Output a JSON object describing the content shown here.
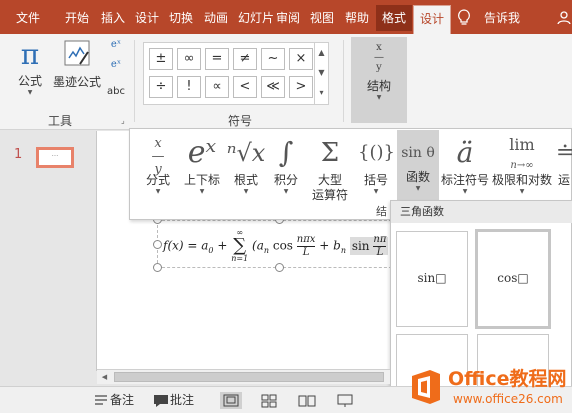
{
  "tabs": [
    "文件",
    "开始",
    "插入",
    "设计",
    "切换",
    "动画",
    "幻灯片",
    "审阅",
    "视图",
    "帮助",
    "格式",
    "设计",
    "告诉我"
  ],
  "ribbon": {
    "formula_label": "公式",
    "ink_formula_label": "墨迹公式",
    "abc_label": "abc",
    "tools_group": "工具",
    "symbols_group": "符号",
    "structure_label": "结构",
    "symbols": [
      "±",
      "∞",
      "=",
      "≠",
      "~",
      "×",
      "÷",
      "!",
      "∝",
      "<",
      "≪",
      ">"
    ]
  },
  "structures": [
    {
      "label": "分式",
      "glyph": "x/y"
    },
    {
      "label": "上下标",
      "glyph": "eˣ"
    },
    {
      "label": "根式",
      "glyph": "ⁿ√x"
    },
    {
      "label": "积分",
      "glyph": "∫"
    },
    {
      "label": "大型",
      "label2": "运算符",
      "glyph": "Σ"
    },
    {
      "label": "括号",
      "glyph": "{()}"
    },
    {
      "label": "函数",
      "glyph": "sin θ"
    },
    {
      "label": "标注符号",
      "glyph": "ä"
    },
    {
      "label": "极限和对数",
      "glyph": "lim"
    },
    {
      "label": "运",
      "glyph": "≐"
    }
  ],
  "structures_group_label": "结",
  "slide": {
    "number": "1",
    "thumb_text": "···"
  },
  "equation": {
    "lhs": "f(x) = a",
    "lhs_sub": "0",
    "plus": "+",
    "sum_top": "∞",
    "sum_bottom": "n=1",
    "body1": "(a",
    "body1_sub": "n",
    "cos": "cos",
    "frac1_num": "nπx",
    "frac1_den": "L",
    "plus2": "+ b",
    "body2_sub": "n",
    "sin": "sin",
    "frac2_num": "nπ",
    "frac2_den": "L"
  },
  "trig_panel": {
    "title": "三角函数",
    "cells": [
      "sin□",
      "cos□",
      "",
      ""
    ]
  },
  "statusbar": {
    "notes": "备注",
    "comments": "批注"
  },
  "watermark": {
    "brand": "Office教程网",
    "url": "www.office26.com"
  },
  "colors": {
    "accent": "#b7472a",
    "contextual": "#8e3019",
    "thumb_border": "#e8826a",
    "watermark_orange": "#ef6c1a"
  }
}
